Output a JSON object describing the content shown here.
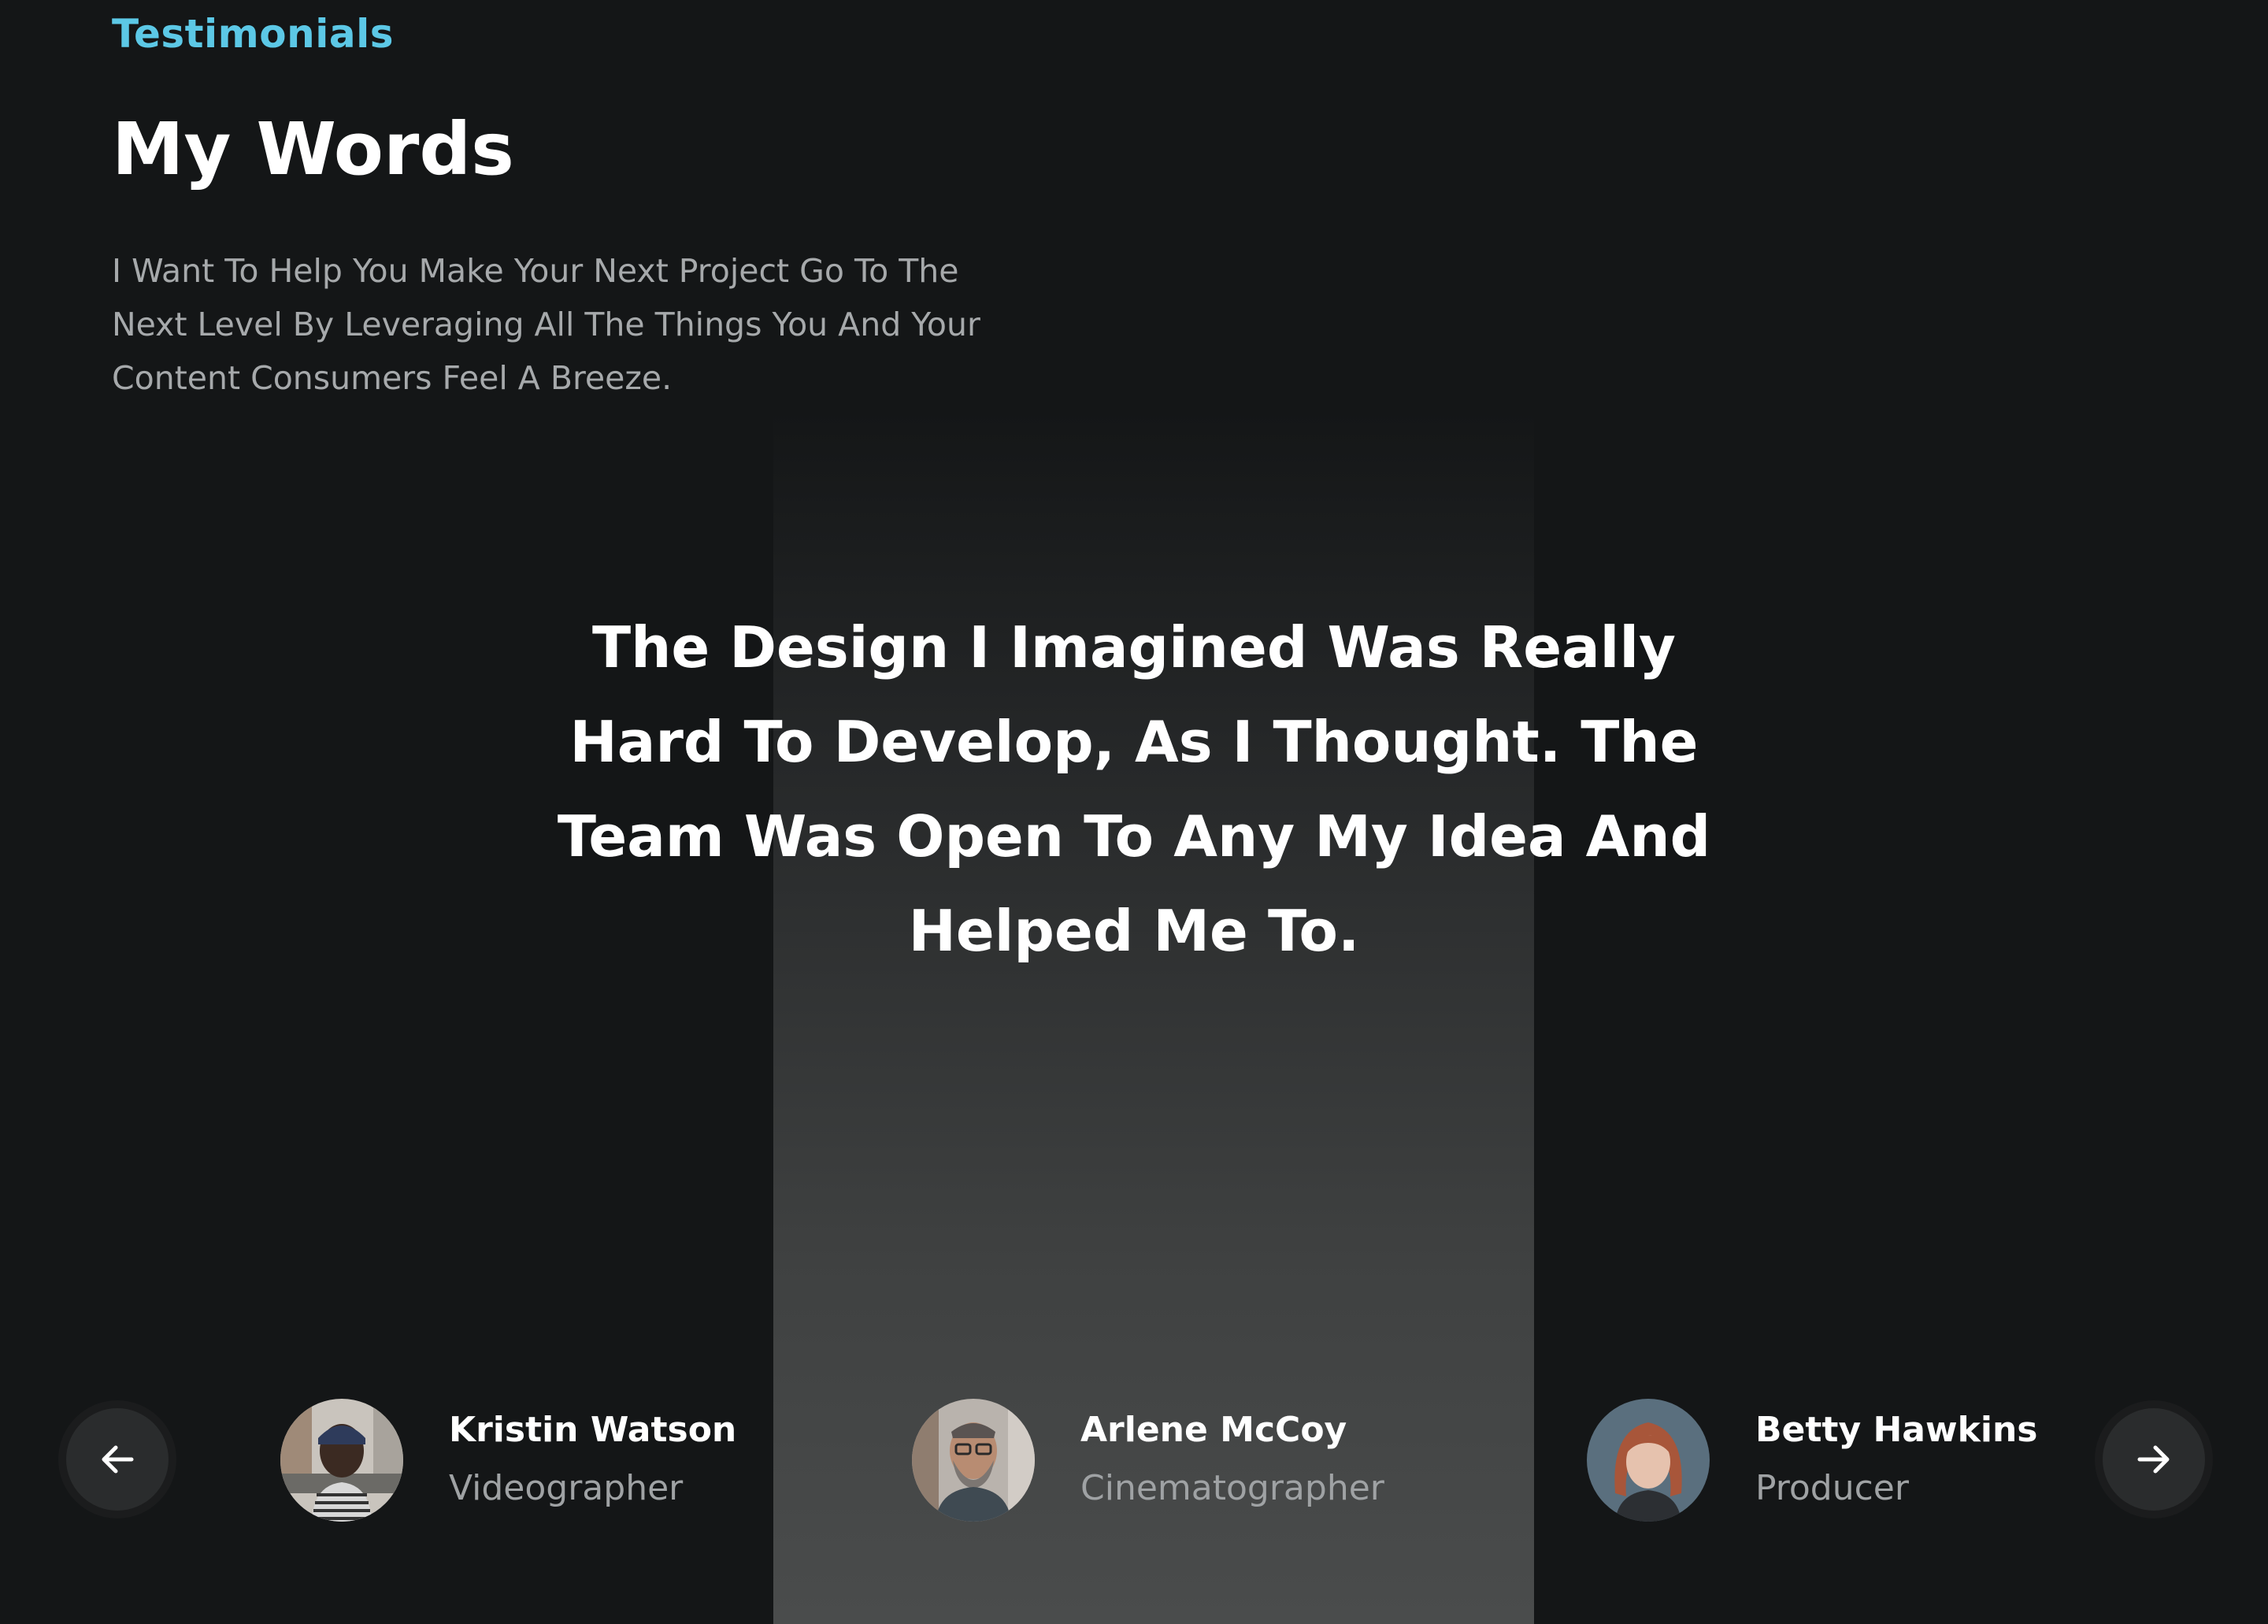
{
  "section": {
    "eyebrow": "Testimonials",
    "title": "My Words",
    "intro": "I Want To Help You Make Your Next Project Go To The Next Level By Leveraging All The Things You And Your Content Consumers Feel A Breeze."
  },
  "testimonial": {
    "quote": "The Design I Imagined Was Really Hard To Develop, As I Thought. The Team Was Open To Any My Idea And Helped Me To."
  },
  "people": [
    {
      "name": "Kristin Watson",
      "role": "Videographer"
    },
    {
      "name": "Arlene McCoy",
      "role": "Cinematographer"
    },
    {
      "name": "Betty Hawkins",
      "role": "Producer"
    }
  ],
  "navigation": {
    "prev_icon": "arrow-left-icon",
    "next_icon": "arrow-right-icon"
  },
  "colors": {
    "accent": "#5cc8e6",
    "background": "#141617",
    "text": "#ffffff",
    "muted": "#a6a9ab"
  }
}
